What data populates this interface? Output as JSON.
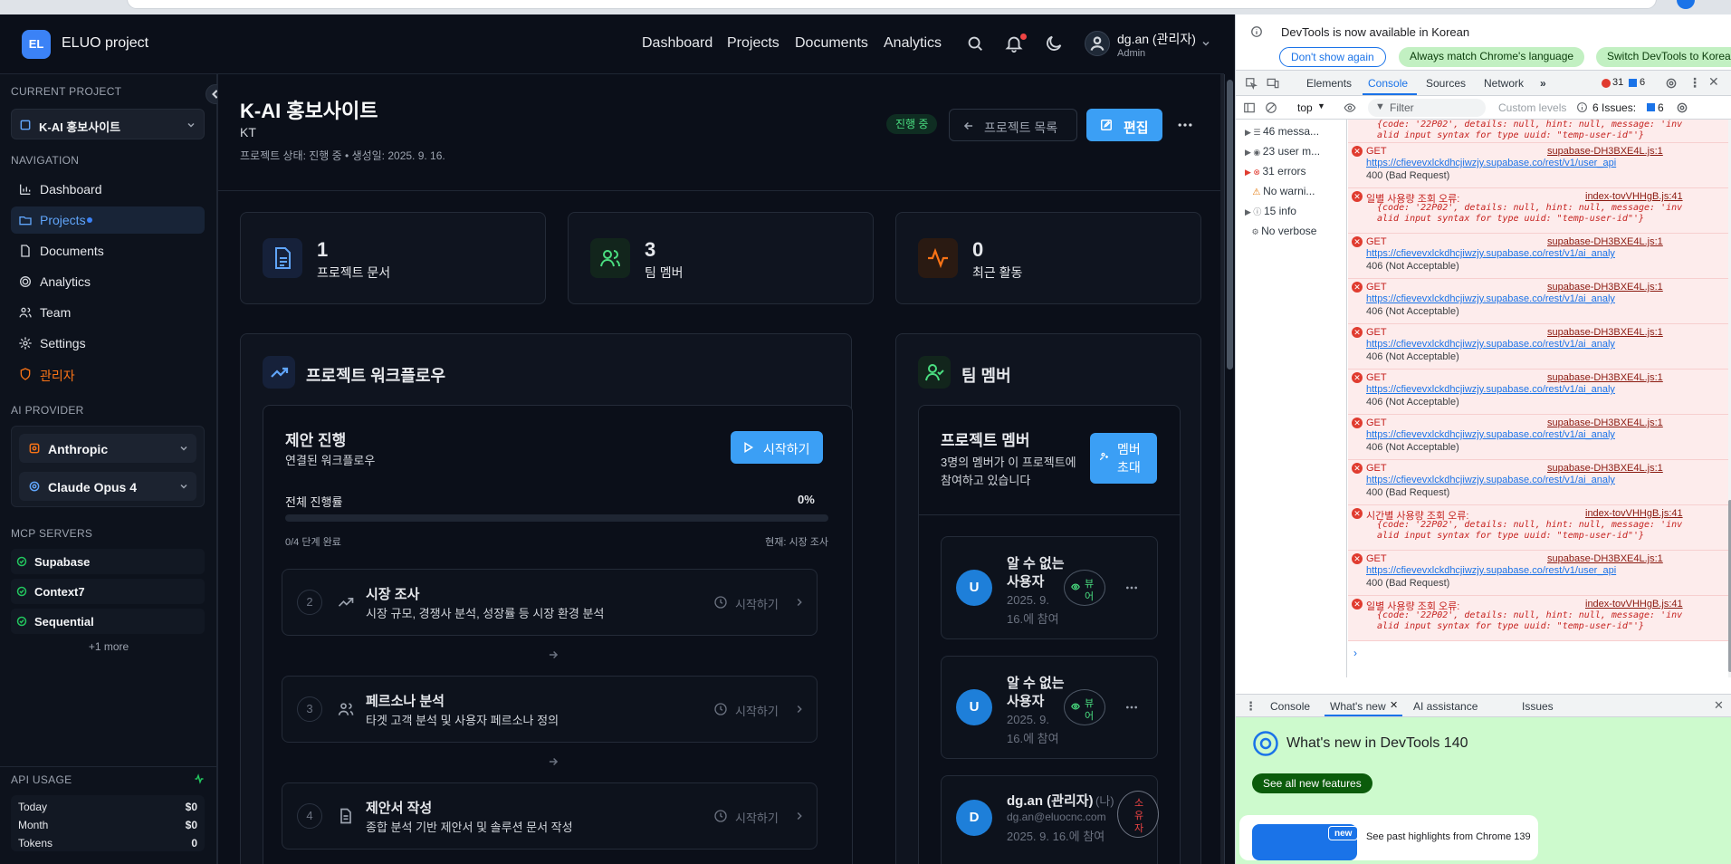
{
  "app": {
    "logo_badge": "EL",
    "logo_text": "ELUO project",
    "nav": [
      "Dashboard",
      "Projects",
      "Documents",
      "Analytics"
    ],
    "user": {
      "name": "dg.an (관리자)",
      "role": "Admin"
    }
  },
  "sidebar": {
    "current_project_label": "CURRENT PROJECT",
    "current_project": "K-AI 홍보사이트",
    "navigation_label": "NAVIGATION",
    "items": [
      {
        "label": "Dashboard",
        "icon": "bar-chart-icon"
      },
      {
        "label": "Projects",
        "icon": "folder-icon"
      },
      {
        "label": "Documents",
        "icon": "document-icon"
      },
      {
        "label": "Analytics",
        "icon": "target-icon"
      },
      {
        "label": "Team",
        "icon": "users-icon"
      },
      {
        "label": "Settings",
        "icon": "gear-icon"
      },
      {
        "label": "관리자",
        "icon": "shield-icon"
      }
    ],
    "ai_provider_label": "AI PROVIDER",
    "provider": "Anthropic",
    "model": "Claude Opus 4",
    "mcp_label": "MCP SERVERS",
    "mcp": [
      "Supabase",
      "Context7",
      "Sequential"
    ],
    "mcp_more": "+1 more",
    "api_label": "API USAGE",
    "api": [
      {
        "label": "Today",
        "value": "$0"
      },
      {
        "label": "Month",
        "value": "$0"
      },
      {
        "label": "Tokens",
        "value": "0"
      }
    ]
  },
  "project": {
    "title": "K-AI 홍보사이트",
    "client": "KT",
    "meta": "프로젝트 상태: 진행 중 • 생성일: 2025. 9. 16.",
    "status_badge": "진행 중",
    "back_button": "프로젝트 목록",
    "edit_button": "편집",
    "stats": [
      {
        "value": "1",
        "label": "프로젝트 문서"
      },
      {
        "value": "3",
        "label": "팀 멤버"
      },
      {
        "value": "0",
        "label": "최근 활동"
      }
    ]
  },
  "workflow": {
    "title": "프로젝트 워크플로우",
    "panel_title": "제안 진행",
    "panel_sub": "연결된 워크플로우",
    "start_button": "시작하기",
    "progress_label": "전체 진행률",
    "progress_value": "0%",
    "progress_fraction": 0,
    "done_text": "0/4 단계 완료",
    "current_text": "현재: 시장 조사",
    "steps": [
      {
        "num": "2",
        "title": "시장 조사",
        "desc": "시장 규모, 경쟁사 분석, 성장률 등 시장 환경 분석",
        "action": "시작하기"
      },
      {
        "num": "3",
        "title": "페르소나 분석",
        "desc": "타겟 고객 분석 및 사용자 페르소나 정의",
        "action": "시작하기"
      },
      {
        "num": "4",
        "title": "제안서 작성",
        "desc": "종합 분석 기반 제안서 및 솔루션 문서 작성",
        "action": "시작하기"
      }
    ]
  },
  "team": {
    "title": "팀 멤버",
    "panel_title": "프로젝트 멤버",
    "panel_sub_1": "3명의 멤버가 이 프로젝트에",
    "panel_sub_2": "참여하고 있습니다",
    "invite_1": "멤버",
    "invite_2": "초대",
    "members": [
      {
        "avatar": "U",
        "name1": "알 수 없는",
        "name2": "사용자",
        "date1": "2025. 9.",
        "date2": "16.에 참여",
        "role1": "뷰",
        "role2": "어"
      },
      {
        "avatar": "U",
        "name1": "알 수 없는",
        "name2": "사용자",
        "date1": "2025. 9.",
        "date2": "16.에 참여",
        "role1": "뷰",
        "role2": "어"
      },
      {
        "avatar": "D",
        "name1": "dg.an (관리자)",
        "me": "(나)",
        "email": "dg.an@eluocnc.com",
        "date1": "2025. 9. 16.에 참여",
        "role1": "소",
        "role2": "유",
        "role3": "자"
      }
    ]
  },
  "devtools": {
    "banner": "DevTools is now available in Korean",
    "btn_dont": "Don't show again",
    "btn_match": "Always match Chrome's language",
    "btn_switch": "Switch DevTools to Korean",
    "tabs": [
      "Elements",
      "Console",
      "Sources",
      "Network"
    ],
    "err_count": "31",
    "warn_count": "6",
    "context": "top",
    "filter_placeholder": "Filter",
    "levels": "Custom levels",
    "issues": "6 Issues:",
    "issues_count": "6",
    "side": [
      {
        "label": "46 messa..."
      },
      {
        "label": "23 user m..."
      },
      {
        "label": "31 errors"
      },
      {
        "label": "No warni..."
      },
      {
        "label": "15 info"
      },
      {
        "label": "No verbose"
      }
    ],
    "logs": [
      {
        "type": "obj",
        "text": "{code: '22P02', details: null, hint: null, message: 'inv",
        "text2": "alid input syntax for type uuid: \"temp-user-id\"'}"
      },
      {
        "type": "get",
        "head": "GET",
        "src": "supabase-DH3BXE4L.js:1",
        "url": "https://cfievevxlckdhcjiwzjy.supabase.co/rest/v1/user_api",
        "status": "400 (Bad Request)"
      },
      {
        "type": "err",
        "head": "일별 사용량 조회 오류:",
        "src": "index-tovVHHgB.js:41",
        "text": "{code: '22P02', details: null, hint: null, message: 'inv",
        "text2": "alid input syntax for type uuid: \"temp-user-id\"'}"
      },
      {
        "type": "get",
        "head": "GET",
        "src": "supabase-DH3BXE4L.js:1",
        "url": "https://cfievevxlckdhcjiwzjy.supabase.co/rest/v1/ai_analy",
        "status": "406 (Not Acceptable)"
      },
      {
        "type": "get",
        "head": "GET",
        "src": "supabase-DH3BXE4L.js:1",
        "url": "https://cfievevxlckdhcjiwzjy.supabase.co/rest/v1/ai_analy",
        "status": "406 (Not Acceptable)"
      },
      {
        "type": "get",
        "head": "GET",
        "src": "supabase-DH3BXE4L.js:1",
        "url": "https://cfievevxlckdhcjiwzjy.supabase.co/rest/v1/ai_analy",
        "status": "406 (Not Acceptable)"
      },
      {
        "type": "get",
        "head": "GET",
        "src": "supabase-DH3BXE4L.js:1",
        "url": "https://cfievevxlckdhcjiwzjy.supabase.co/rest/v1/ai_analy",
        "status": "406 (Not Acceptable)"
      },
      {
        "type": "get",
        "head": "GET",
        "src": "supabase-DH3BXE4L.js:1",
        "url": "https://cfievevxlckdhcjiwzjy.supabase.co/rest/v1/ai_analy",
        "status": "406 (Not Acceptable)"
      },
      {
        "type": "get",
        "head": "GET",
        "src": "supabase-DH3BXE4L.js:1",
        "url": "https://cfievevxlckdhcjiwzjy.supabase.co/rest/v1/ai_analy",
        "status": "400 (Bad Request)"
      },
      {
        "type": "err",
        "head": "시간별 사용량 조회 오류:",
        "src": "index-tovVHHgB.js:41",
        "text": "{code: '22P02', details: null, hint: null, message: 'inv",
        "text2": "alid input syntax for type uuid: \"temp-user-id\"'}"
      },
      {
        "type": "get",
        "head": "GET",
        "src": "supabase-DH3BXE4L.js:1",
        "url": "https://cfievevxlckdhcjiwzjy.supabase.co/rest/v1/user_api",
        "status": "400 (Bad Request)"
      },
      {
        "type": "err",
        "head": "일별 사용량 조회 오류:",
        "src": "index-tovVHHgB.js:41",
        "text": "{code: '22P02', details: null, hint: null, message: 'inv",
        "text2": "alid input syntax for type uuid: \"temp-user-id\"'}"
      }
    ],
    "drawer_tabs": [
      "Console",
      "What's new",
      "AI assistance",
      "Issues"
    ],
    "whatsnew_title": "What's new in DevTools 140",
    "see_all": "See all new features",
    "new_badge": "new",
    "highlight": "See past highlights from Chrome 139"
  }
}
